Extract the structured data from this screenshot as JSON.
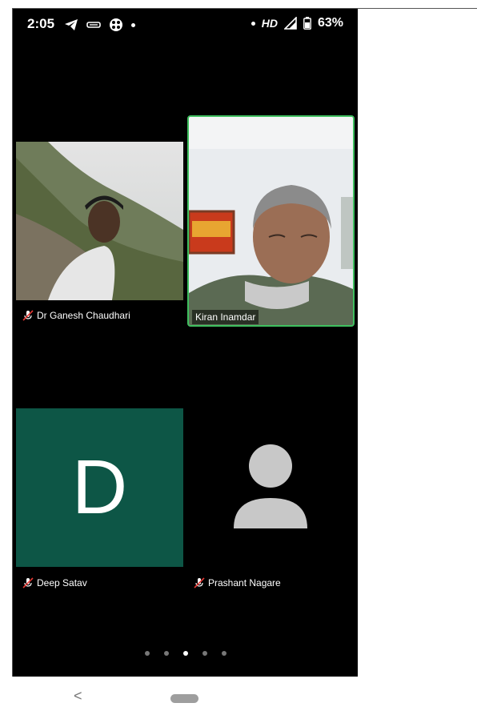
{
  "status_bar": {
    "time": "2:05",
    "hd_label": "HD",
    "battery": "63%",
    "icons": [
      "telegram-icon",
      "app-icon",
      "game-icon",
      "signal-icon",
      "battery-icon"
    ]
  },
  "participants": [
    {
      "name": "Dr Ganesh Chaudhari",
      "muted": true,
      "type": "video"
    },
    {
      "name": "Kiran Inamdar",
      "muted": false,
      "type": "video",
      "active_speaker": true
    },
    {
      "name": "Deep Satav",
      "muted": true,
      "type": "avatar-letter",
      "letter": "D",
      "avatar_color": "#0d5646"
    },
    {
      "name": "Prashant Nagare",
      "muted": true,
      "type": "avatar-placeholder"
    }
  ],
  "pagination": {
    "total": 5,
    "current": 3
  },
  "colors": {
    "active_border": "#3fbf5f",
    "background": "#000000"
  }
}
